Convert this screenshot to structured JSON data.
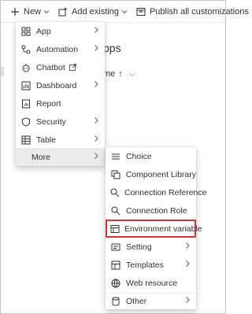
{
  "commandbar": {
    "new_label": "New",
    "add_existing_label": "Add existing",
    "publish_label": "Publish all customizations"
  },
  "background": {
    "title_fragment": "pps",
    "column_fragment": "me",
    "sort_arrow": "↑"
  },
  "new_menu": {
    "items": [
      {
        "label": "App",
        "icon": "app-icon",
        "has_submenu": true
      },
      {
        "label": "Automation",
        "icon": "automation-icon",
        "has_submenu": true
      },
      {
        "label": "Chatbot",
        "icon": "chatbot-icon",
        "has_submenu": false,
        "external": true
      },
      {
        "label": "Dashboard",
        "icon": "dashboard-icon",
        "has_submenu": true
      },
      {
        "label": "Report",
        "icon": "report-icon",
        "has_submenu": false
      },
      {
        "label": "Security",
        "icon": "shield-icon",
        "has_submenu": true
      },
      {
        "label": "Table",
        "icon": "table-icon",
        "has_submenu": true
      },
      {
        "label": "More",
        "icon": "",
        "has_submenu": true,
        "highlighted": true
      }
    ]
  },
  "more_menu": {
    "items": [
      {
        "label": "Choice",
        "icon": "choice-icon",
        "has_submenu": false
      },
      {
        "label": "Component Library",
        "icon": "component-library-icon",
        "has_submenu": false
      },
      {
        "label": "Connection Reference",
        "icon": "connection-reference-icon",
        "has_submenu": false
      },
      {
        "label": "Connection Role",
        "icon": "connection-role-icon",
        "has_submenu": false
      },
      {
        "label": "Environment variable",
        "icon": "environment-variable-icon",
        "has_submenu": false,
        "boxed": true
      },
      {
        "label": "Setting",
        "icon": "setting-icon",
        "has_submenu": true
      },
      {
        "label": "Templates",
        "icon": "templates-icon",
        "has_submenu": true
      },
      {
        "label": "Web resource",
        "icon": "web-resource-icon",
        "has_submenu": false
      },
      {
        "label": "Other",
        "icon": "database-icon",
        "has_submenu": true
      }
    ]
  },
  "colors": {
    "highlight": "#edebe9",
    "box_outline": "#d13438",
    "text": "#323130"
  }
}
